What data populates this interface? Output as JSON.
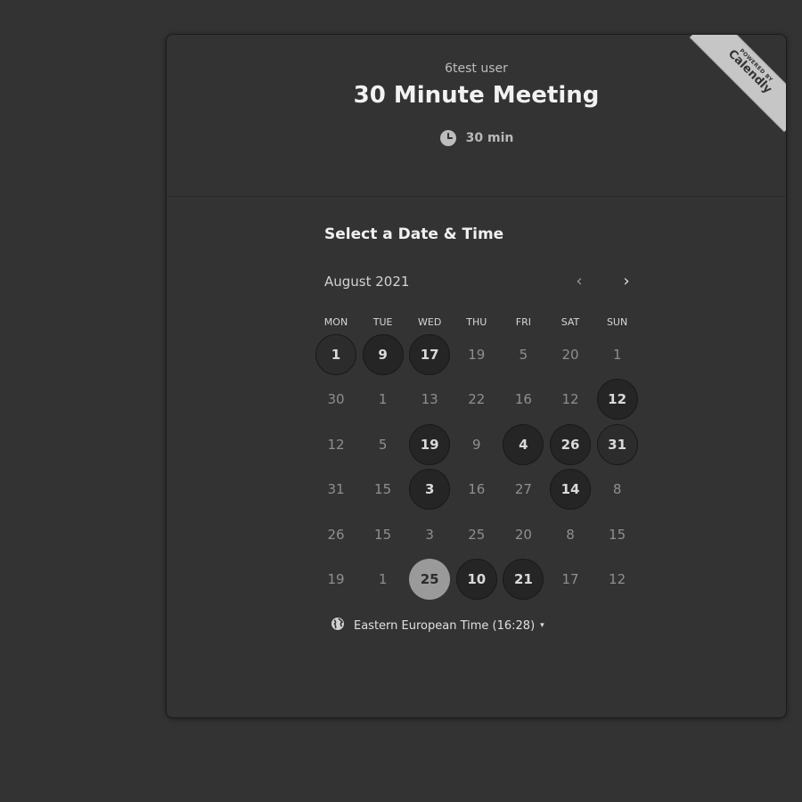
{
  "event": {
    "owner": "6test user",
    "title": "30 Minute Meeting",
    "duration": "30 min",
    "duration_icon": "clock-icon"
  },
  "ribbon": {
    "small": "POWERED BY",
    "brand": "Calendly"
  },
  "picker": {
    "title": "Select a Date & Time",
    "month": "August 2021",
    "prev_icon": "‹",
    "next_icon": "›",
    "weekdays": [
      "MON",
      "TUE",
      "WED",
      "THU",
      "FRI",
      "SAT",
      "SUN"
    ],
    "weeks": [
      [
        {
          "n": "1",
          "s": "avail-light"
        },
        {
          "n": "9",
          "s": "avail"
        },
        {
          "n": "17",
          "s": "avail"
        },
        {
          "n": "19"
        },
        {
          "n": "5"
        },
        {
          "n": "20"
        },
        {
          "n": "1"
        }
      ],
      [
        {
          "n": "30"
        },
        {
          "n": "1"
        },
        {
          "n": "13"
        },
        {
          "n": "22"
        },
        {
          "n": "16"
        },
        {
          "n": "12"
        },
        {
          "n": "12",
          "s": "avail"
        }
      ],
      [
        {
          "n": "12"
        },
        {
          "n": "5"
        },
        {
          "n": "19",
          "s": "avail"
        },
        {
          "n": "9"
        },
        {
          "n": "4",
          "s": "avail"
        },
        {
          "n": "26",
          "s": "avail"
        },
        {
          "n": "31",
          "s": "avail-light"
        }
      ],
      [
        {
          "n": "31"
        },
        {
          "n": "15"
        },
        {
          "n": "3",
          "s": "avail"
        },
        {
          "n": "16"
        },
        {
          "n": "27"
        },
        {
          "n": "14",
          "s": "avail"
        },
        {
          "n": "8"
        }
      ],
      [
        {
          "n": "26"
        },
        {
          "n": "15"
        },
        {
          "n": "3"
        },
        {
          "n": "25"
        },
        {
          "n": "20"
        },
        {
          "n": "8"
        },
        {
          "n": "15"
        }
      ],
      [
        {
          "n": "19"
        },
        {
          "n": "1"
        },
        {
          "n": "25",
          "s": "selected"
        },
        {
          "n": "10",
          "s": "avail"
        },
        {
          "n": "21",
          "s": "avail"
        },
        {
          "n": "17"
        },
        {
          "n": "12"
        }
      ]
    ]
  },
  "timezone": {
    "label": "Eastern European Time (16:28)",
    "icon": "globe-icon",
    "caret": "▾"
  },
  "colors": {
    "background": "#333333",
    "available_day": "#252525",
    "selected_day": "#9a9a9a",
    "ribbon": "#c6c6c6"
  }
}
